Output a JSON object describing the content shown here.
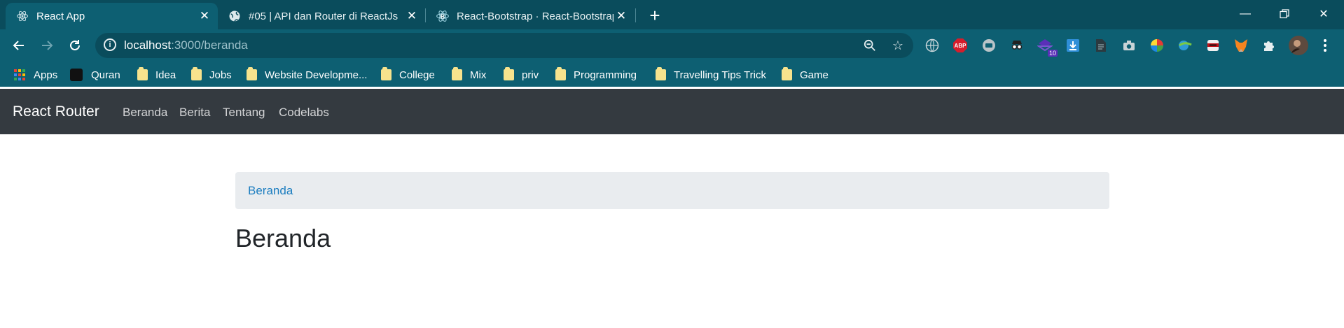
{
  "browser": {
    "tabs": [
      {
        "title": "React App",
        "favicon": "react-icon",
        "active": true
      },
      {
        "title": "#05 | API dan Router di ReactJs",
        "favicon": "globe-icon",
        "active": false
      },
      {
        "title": "React-Bootstrap · React-Bootstrap",
        "favicon": "react-bootstrap-icon",
        "active": false
      }
    ],
    "url_host": "localhost",
    "url_path": ":3000/beranda",
    "bookmarks": [
      "Apps",
      "Quran",
      "Idea",
      "Jobs",
      "Website Developme...",
      "College",
      "Mix",
      "priv",
      "Programming",
      "Travelling Tips Trick",
      "Game"
    ],
    "extensions": {
      "badge_count": "10",
      "abp_label": "ABP"
    },
    "accent": "#0d5f72"
  },
  "app": {
    "brand": "React Router",
    "nav": [
      "Beranda",
      "Berita",
      "Tentang",
      "Codelabs"
    ],
    "breadcrumb": "Beranda",
    "heading": "Beranda"
  }
}
